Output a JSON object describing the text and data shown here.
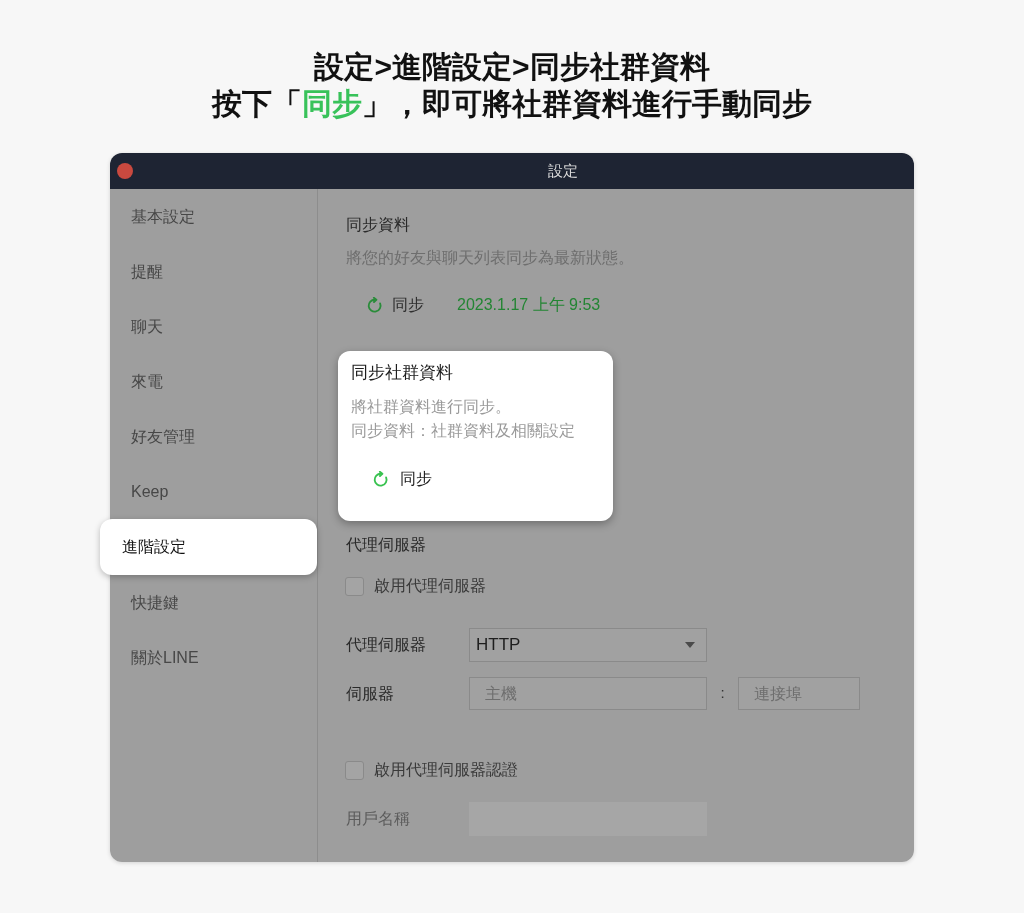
{
  "caption": {
    "line_1": "設定>進階設定>同步社群資料",
    "line_2": [
      {
        "text": "按下「",
        "highlight": false
      },
      {
        "text": "同步",
        "highlight": true
      },
      {
        "text": "」，即可將社群資料進行手動同步",
        "highlight": false
      }
    ]
  },
  "window": {
    "title": "設定"
  },
  "sidebar": {
    "items": [
      {
        "label": "基本設定",
        "selected": false
      },
      {
        "label": "提醒",
        "selected": false
      },
      {
        "label": "聊天",
        "selected": false
      },
      {
        "label": "來電",
        "selected": false
      },
      {
        "label": "好友管理",
        "selected": false
      },
      {
        "label": "Keep",
        "selected": false
      },
      {
        "label": "進階設定",
        "selected": true
      },
      {
        "label": "快捷鍵",
        "selected": false
      },
      {
        "label": "關於LINE",
        "selected": false
      }
    ]
  },
  "sync_data": {
    "title": "同步資料",
    "description": "將您的好友與聊天列表同步為最新狀態。",
    "button": "同步",
    "last_synced": "2023.1.17 上午 9:53"
  },
  "community_sync": {
    "title": "同步社群資料",
    "description_lines": [
      "將社群資料進行同步。",
      "同步資料：社群資料及相關設定"
    ],
    "button": "同步"
  },
  "proxy": {
    "title": "代理伺服器",
    "enable": {
      "label": "啟用代理伺服器",
      "checked": false
    },
    "type": {
      "label": "代理伺服器",
      "value": "HTTP"
    },
    "server": {
      "label": "伺服器",
      "host_placeholder": "主機",
      "separator": ":",
      "port_placeholder": "連接埠"
    },
    "auth": {
      "label": "啟用代理伺服器認證",
      "checked": false
    },
    "username": {
      "label": "用戶名稱",
      "disabled": true
    }
  }
}
